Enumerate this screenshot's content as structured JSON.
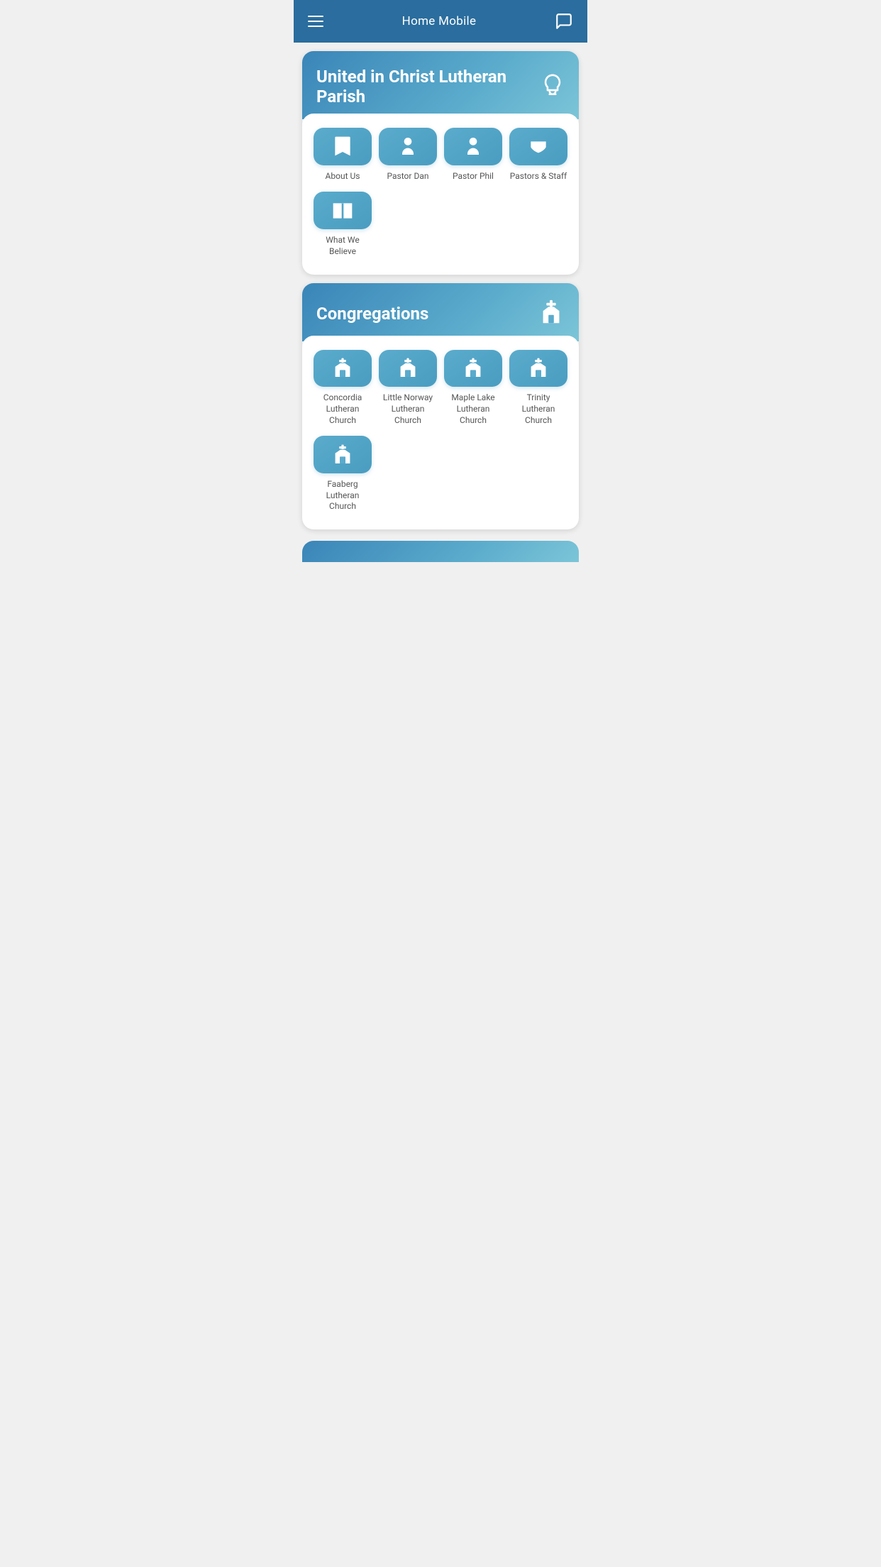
{
  "navbar": {
    "title": "Home Mobile",
    "hamburger_label": "menu",
    "chat_label": "chat"
  },
  "parish_section": {
    "title": "United in Christ Lutheran Parish",
    "header_icon": "lightbulb",
    "items": [
      {
        "id": "about-us",
        "label": "About Us",
        "icon": "bookmark"
      },
      {
        "id": "pastor-dan",
        "label": "Pastor Dan",
        "icon": "person"
      },
      {
        "id": "pastor-phil",
        "label": "Pastor Phil",
        "icon": "person"
      },
      {
        "id": "pastors-staff",
        "label": "Pastors & Staff",
        "icon": "hand-heart"
      }
    ],
    "items_row2": [
      {
        "id": "what-we-believe",
        "label": "What We Believe",
        "icon": "book"
      }
    ]
  },
  "congregations_section": {
    "title": "Congregations",
    "header_icon": "church",
    "items": [
      {
        "id": "concordia",
        "label": "Concordia Lutheran Church",
        "icon": "church"
      },
      {
        "id": "little-norway",
        "label": "Little Norway Lutheran Church",
        "icon": "church"
      },
      {
        "id": "maple-lake",
        "label": "Maple Lake Lutheran Church",
        "icon": "church"
      },
      {
        "id": "trinity",
        "label": "Trinity Lutheran Church",
        "icon": "church"
      }
    ],
    "items_row2": [
      {
        "id": "faaberg",
        "label": "Faaberg Lutheran Church",
        "icon": "church"
      }
    ]
  },
  "bottom_section": {
    "visible": true
  },
  "colors": {
    "nav_bg": "#2a6d9e",
    "section_gradient_start": "#3a85b8",
    "section_gradient_end": "#7cc5d8",
    "btn_color": "#5aabcc",
    "label_color": "#555555"
  }
}
